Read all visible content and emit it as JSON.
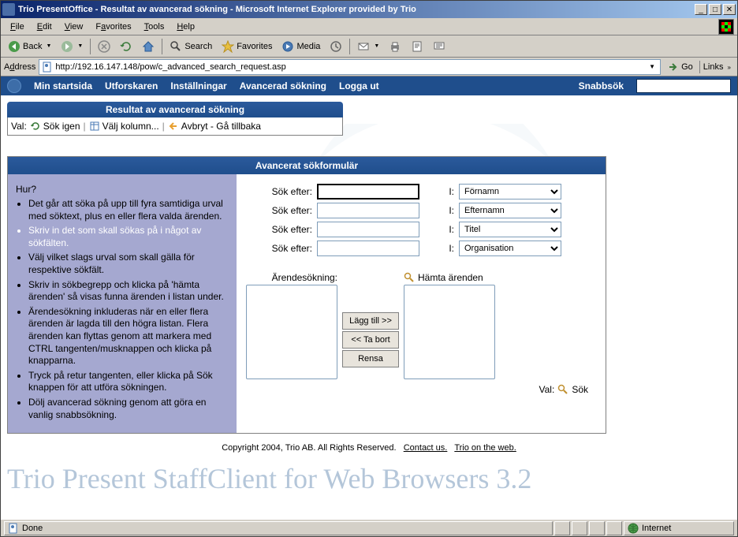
{
  "titlebar": "Trio PresentOffice - Resultat av avancerad sökning - Microsoft Internet Explorer provided by Trio",
  "menus": {
    "file": "File",
    "edit": "Edit",
    "view": "View",
    "favorites": "Favorites",
    "tools": "Tools",
    "help": "Help"
  },
  "toolbar": {
    "back": "Back",
    "search": "Search",
    "favorites": "Favorites",
    "media": "Media"
  },
  "address": {
    "label": "Address",
    "url": "http://192.16.147.148/pow/c_advanced_search_request.asp",
    "go": "Go",
    "links": "Links"
  },
  "nav": {
    "startpage": "Min startsida",
    "explorer": "Utforskaren",
    "settings": "Inställningar",
    "advsearch": "Avancerad sökning",
    "logout": "Logga ut",
    "quicksearch": "Snabbsök"
  },
  "result": {
    "title": "Resultat av avancerad sökning",
    "val": "Val:",
    "searchagain": "Sök igen",
    "choosecols": "Välj kolumn...",
    "cancel": "Avbryt - Gå tillbaka"
  },
  "form": {
    "title": "Avancerat sökformulär",
    "help": {
      "heading": "Hur?",
      "items": [
        "Det går att söka på upp till fyra samtidiga urval med söktext, plus en eller flera valda ärenden.",
        "Skriv in det som skall sökas på i något av sökfälten.",
        "Välj vilket slags urval som skall gälla för respektive sökfält.",
        "Skriv in sökbegrepp och klicka på 'hämta ärenden' så visas funna ärenden i listan under.",
        "Ärendesökning inkluderas när en eller flera ärenden är lagda till den högra listan. Flera ärenden kan flyttas genom att markera med CTRL tangenten/musknappen och klicka på knapparna.",
        "Tryck på retur tangenten, eller klicka på Sök knappen för att utföra sökningen.",
        "Dölj avancerad sökning genom att göra en vanlig snabbsökning."
      ]
    },
    "searchlabel": "Sök efter:",
    "ilabel": "I:",
    "options": {
      "o1": "Förnamn",
      "o2": "Efternamn",
      "o3": "Titel",
      "o4": "Organisation"
    },
    "caselabel": "Ärendesökning:",
    "fetch": "Hämta ärenden",
    "add": "Lägg till >>",
    "remove": "<< Ta bort",
    "clear": "Rensa",
    "bottomval": "Val:",
    "searchbtn": "Sök"
  },
  "footer": {
    "copyright": "Copyright 2004, Trio AB. All Rights Reserved.",
    "contact": "Contact us.",
    "trio": "Trio on the web."
  },
  "watermark_text": "Trio Present StaffClient for Web Browsers 3.2",
  "status": {
    "done": "Done",
    "zone": "Internet"
  }
}
